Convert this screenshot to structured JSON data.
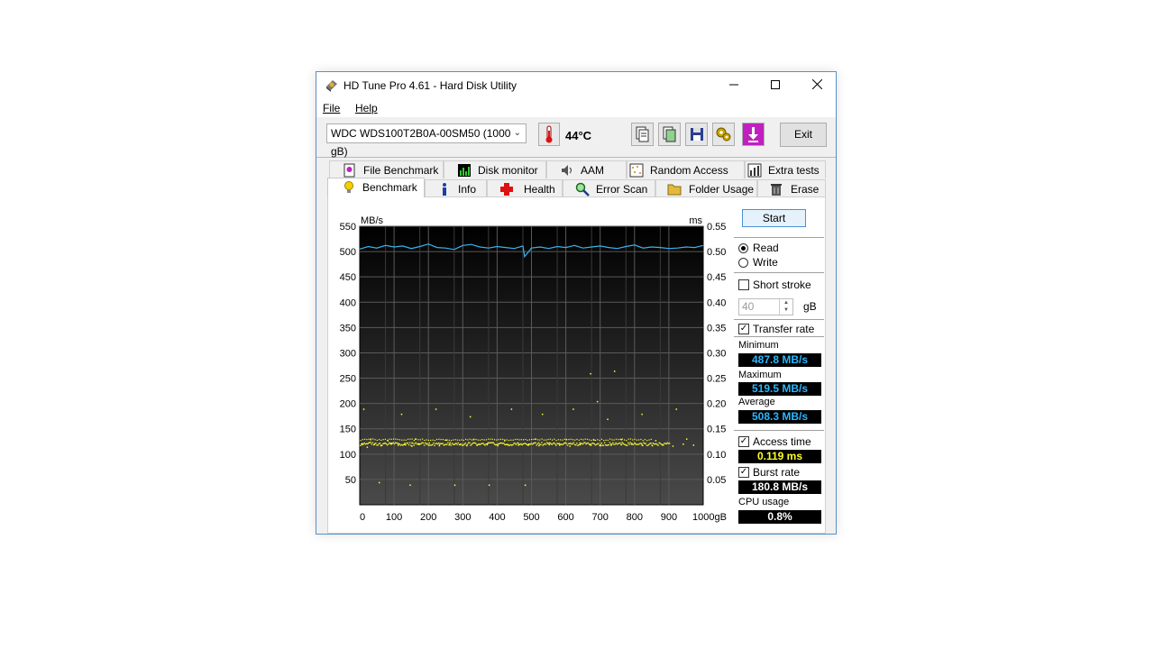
{
  "window": {
    "title": "HD Tune Pro 4.61 - Hard Disk Utility"
  },
  "menu": {
    "file": "File",
    "help": "Help"
  },
  "toolbar": {
    "drive": "WDC WDS100T2B0A-00SM50 (1000 gB)",
    "temperature": "44°C",
    "exit_label": "Exit",
    "icons": [
      "copy-text-icon",
      "copy-screenshot-icon",
      "save-icon",
      "options-icon",
      "download-icon"
    ]
  },
  "tabs_top": [
    "File Benchmark",
    "Disk monitor",
    "AAM",
    "Random Access",
    "Extra tests"
  ],
  "tabs_bottom": [
    "Benchmark",
    "Info",
    "Health",
    "Error Scan",
    "Folder Usage",
    "Erase"
  ],
  "active_tab": "Benchmark",
  "side": {
    "start_label": "Start",
    "read_label": "Read",
    "write_label": "Write",
    "short_stroke_label": "Short stroke",
    "stroke_value": "40",
    "stroke_unit": "gB",
    "transfer_rate_label": "Transfer rate",
    "minimum_label": "Minimum",
    "minimum_value": "487.8 MB/s",
    "maximum_label": "Maximum",
    "maximum_value": "519.5 MB/s",
    "average_label": "Average",
    "average_value": "508.3 MB/s",
    "access_time_label": "Access time",
    "access_time_value": "0.119 ms",
    "burst_rate_label": "Burst rate",
    "burst_rate_value": "180.8 MB/s",
    "cpu_label": "CPU usage",
    "cpu_value": "0.8%",
    "read_selected": true,
    "short_stroke_checked": false,
    "transfer_rate_checked": true,
    "access_time_checked": true,
    "burst_rate_checked": true
  },
  "chart_data": {
    "type": "line",
    "y_left_unit": "MB/s",
    "y_right_unit": "ms",
    "y_left_ticks": [
      "550",
      "500",
      "450",
      "400",
      "350",
      "300",
      "250",
      "200",
      "150",
      "100",
      "50"
    ],
    "y_right_ticks": [
      "0.55",
      "0.50",
      "0.45",
      "0.40",
      "0.35",
      "0.30",
      "0.25",
      "0.20",
      "0.15",
      "0.10",
      "0.05"
    ],
    "x_ticks": [
      "0",
      "100",
      "200",
      "300",
      "400",
      "500",
      "600",
      "700",
      "800",
      "900",
      "1000gB"
    ],
    "ylim_left": [
      0,
      550
    ],
    "ylim_right": [
      0,
      0.55
    ],
    "xlim": [
      0,
      1000
    ],
    "grid": true,
    "colors": {
      "transfer": "#34b4ee",
      "access": "#ffff33",
      "background_top": "#000000",
      "background_bottom": "#4a4a4a",
      "grid": "#5a5a5a"
    },
    "transfer_rate_series": {
      "name": "Transfer rate",
      "x": [
        0,
        25,
        50,
        75,
        100,
        125,
        150,
        175,
        200,
        225,
        250,
        275,
        300,
        325,
        350,
        375,
        400,
        425,
        450,
        475,
        480,
        500,
        525,
        550,
        575,
        600,
        625,
        650,
        675,
        700,
        725,
        750,
        775,
        800,
        825,
        850,
        875,
        900,
        925,
        950,
        975,
        1000
      ],
      "y": [
        505,
        510,
        507,
        512,
        509,
        511,
        506,
        510,
        515,
        508,
        507,
        504,
        512,
        514,
        509,
        507,
        510,
        508,
        506,
        511,
        490,
        507,
        509,
        506,
        510,
        508,
        512,
        507,
        509,
        511,
        508,
        506,
        510,
        513,
        507,
        509,
        508,
        506,
        507,
        509,
        508,
        512
      ]
    },
    "access_time_series": {
      "name": "Access time",
      "description_main_band_ms": [
        0.11,
        0.13
      ],
      "points_x": [
        5,
        20,
        40,
        60,
        90,
        110,
        130,
        150,
        170,
        200,
        230,
        260,
        290,
        310,
        340,
        370,
        400,
        430,
        460,
        490,
        520,
        550,
        580,
        610,
        640,
        670,
        700,
        730,
        760,
        790,
        820,
        850,
        880,
        910,
        940,
        970,
        30,
        80,
        160,
        250,
        330,
        420,
        510,
        600,
        680,
        760,
        860,
        950,
        10,
        120,
        220,
        320,
        440,
        530,
        620,
        720,
        820,
        920,
        670,
        740,
        690,
        480,
        55,
        145,
        275,
        375
      ],
      "points_y": [
        0.12,
        0.115,
        0.12,
        0.118,
        0.121,
        0.119,
        0.12,
        0.117,
        0.122,
        0.119,
        0.118,
        0.121,
        0.12,
        0.118,
        0.119,
        0.122,
        0.118,
        0.12,
        0.119,
        0.121,
        0.118,
        0.12,
        0.119,
        0.117,
        0.12,
        0.121,
        0.118,
        0.119,
        0.12,
        0.122,
        0.119,
        0.118,
        0.12,
        0.117,
        0.121,
        0.119,
        0.13,
        0.128,
        0.131,
        0.129,
        0.13,
        0.128,
        0.131,
        0.13,
        0.129,
        0.13,
        0.128,
        0.131,
        0.19,
        0.18,
        0.19,
        0.175,
        0.19,
        0.18,
        0.19,
        0.17,
        0.18,
        0.19,
        0.26,
        0.265,
        0.205,
        0.04,
        0.045,
        0.04,
        0.04,
        0.04
      ]
    }
  }
}
